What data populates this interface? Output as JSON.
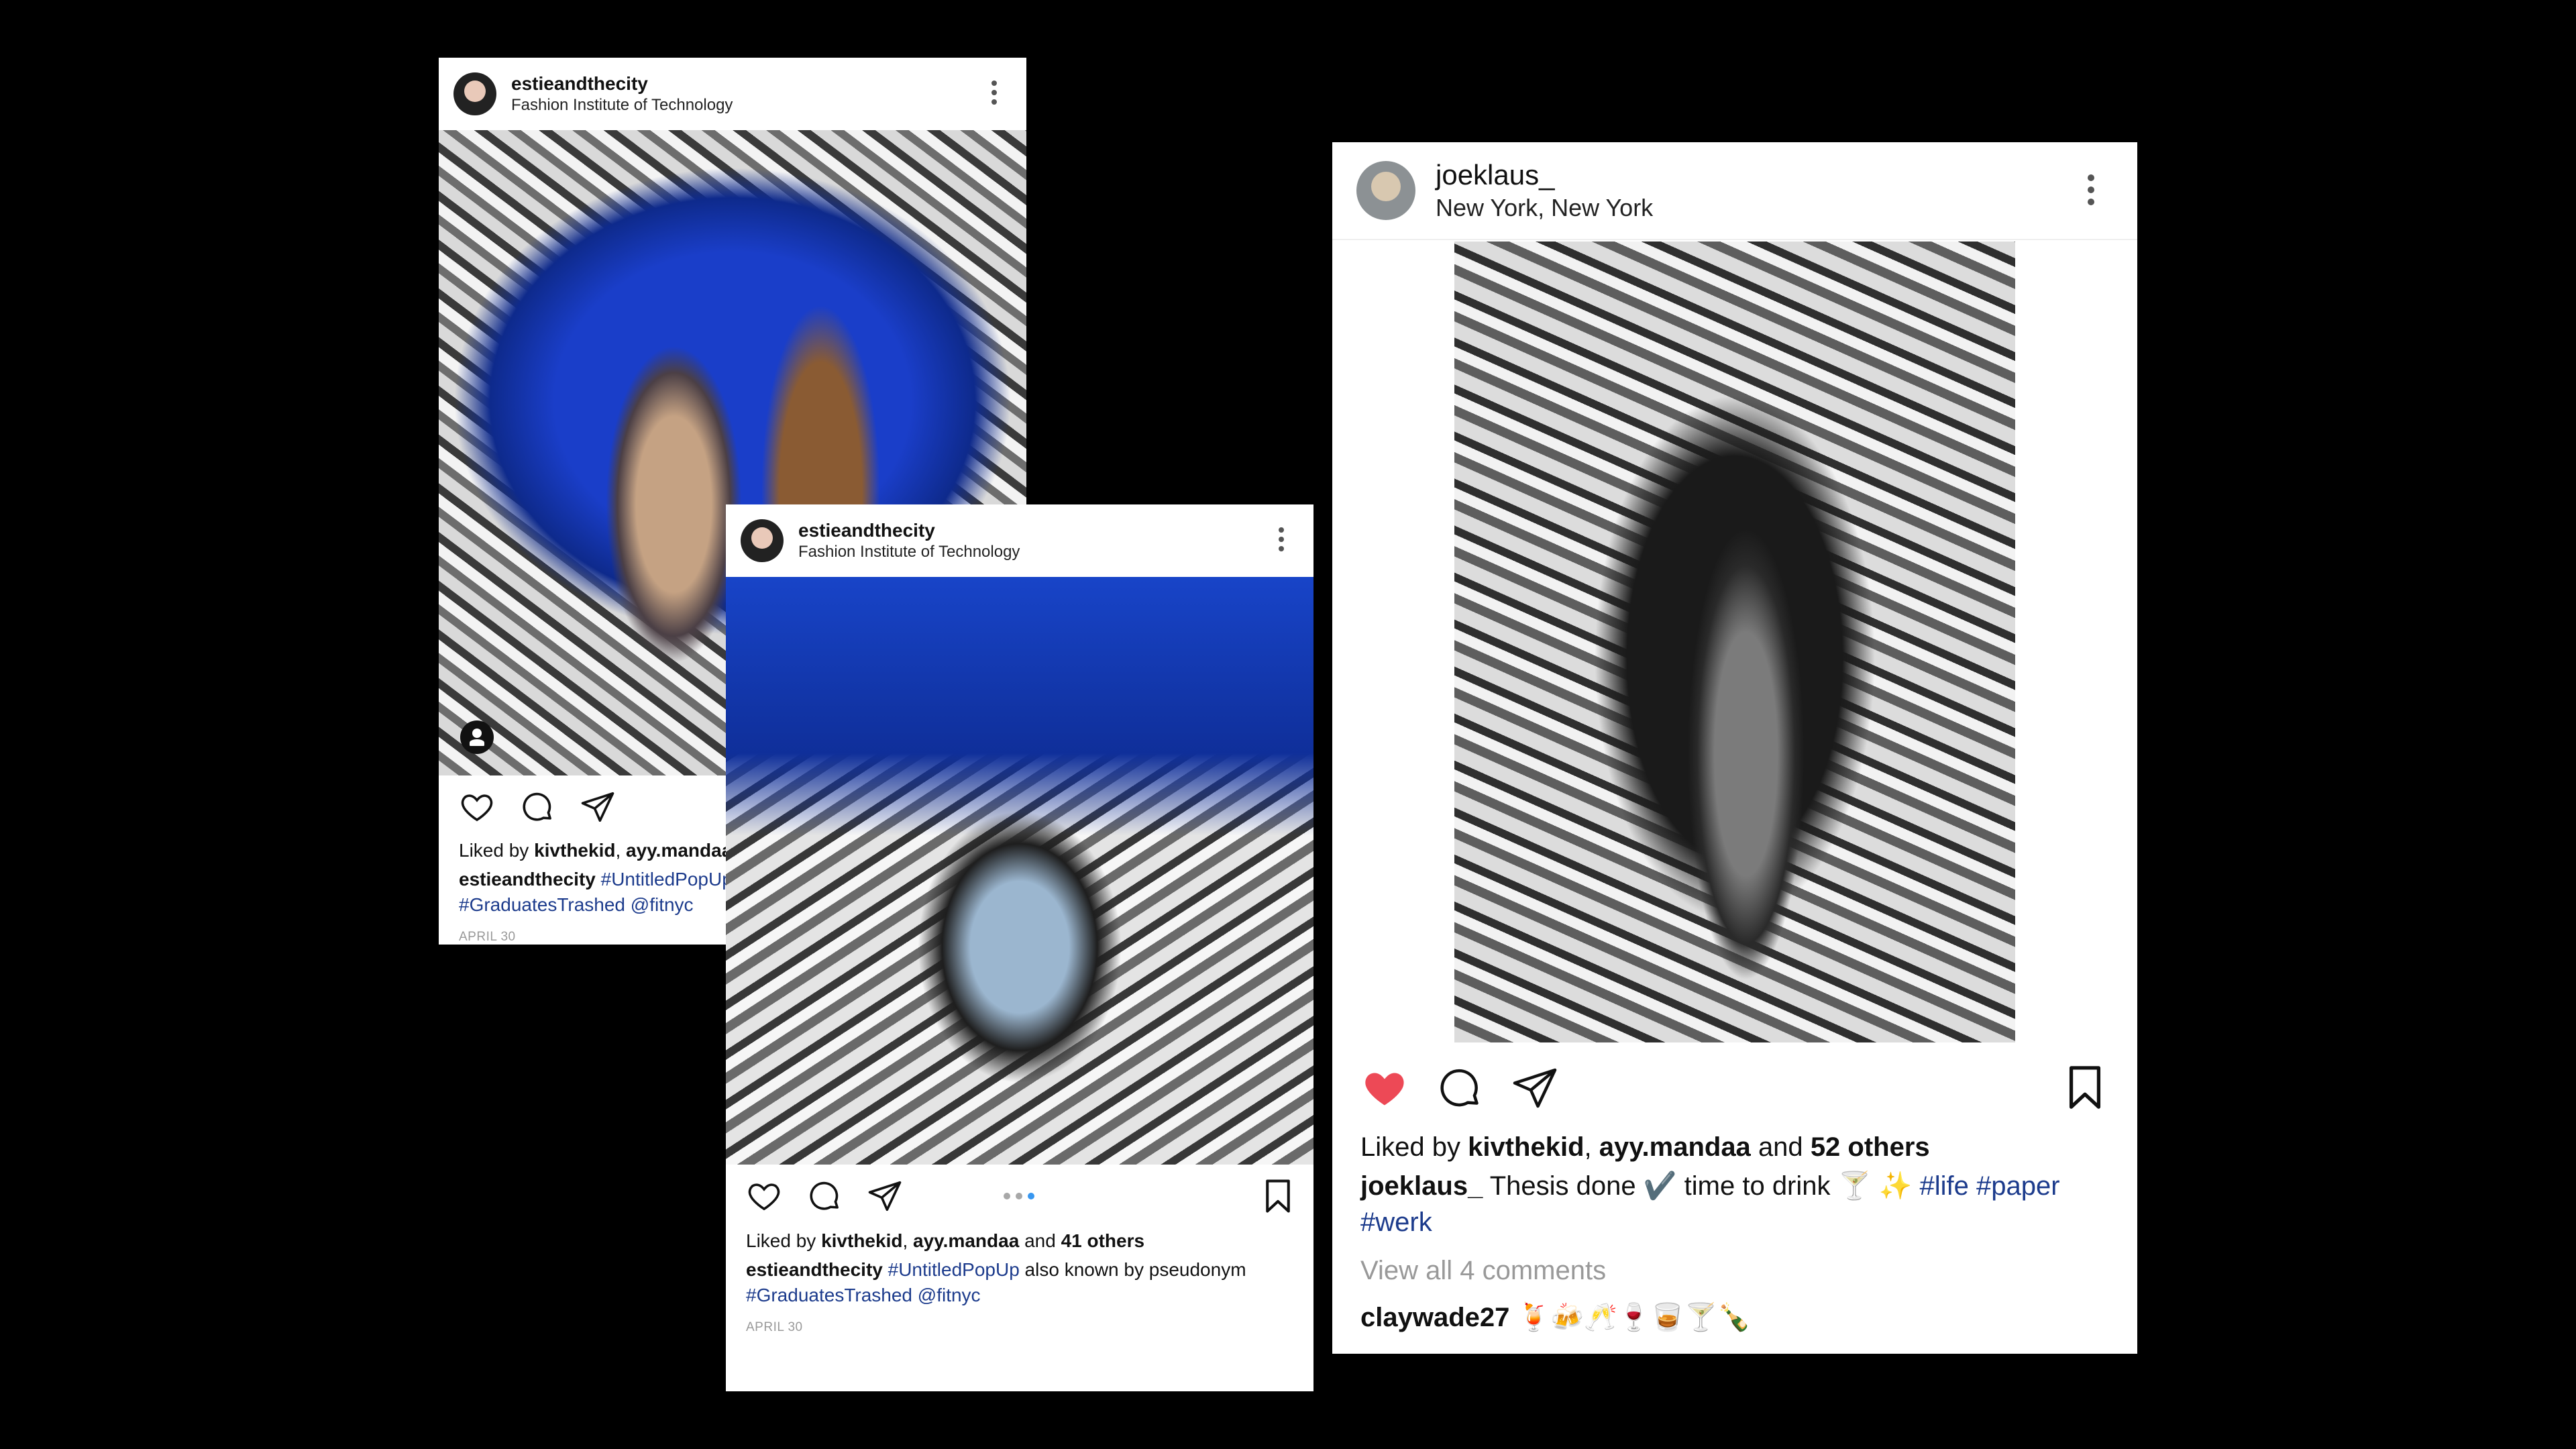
{
  "posts": [
    {
      "username": "estieandthecity",
      "location": "Fashion Institute of Technology",
      "liked_prefix": "Liked by",
      "liked_user1": "kivthekid",
      "liked_user2": "ayy.mandaa",
      "caption_user": "estieandthecity",
      "caption_tag1": "#UntitledPopUp",
      "caption_tag2": "#GraduatesTrashed",
      "caption_mention": "@fitnyc",
      "date": "APRIL 30"
    },
    {
      "username": "estieandthecity",
      "location": "Fashion Institute of Technology",
      "liked_prefix": "Liked by",
      "liked_user1": "kivthekid",
      "liked_user2": "ayy.mandaa",
      "liked_and": "and",
      "liked_others": "41 others",
      "caption_user": "estieandthecity",
      "caption_tag1": "#UntitledPopUp",
      "caption_text": "also known by pseudonym",
      "caption_tag2": "#GraduatesTrashed",
      "caption_mention": "@fitnyc",
      "date": "APRIL 30",
      "carousel_active_index": 3,
      "carousel_count": 3
    },
    {
      "username": "joeklaus_",
      "location": "New York, New York",
      "liked_prefix": "Liked by",
      "liked_user1": "kivthekid",
      "liked_user2": "ayy.mandaa",
      "liked_and": "and",
      "liked_others": "52 others",
      "caption_user": "joeklaus_",
      "caption_text": "Thesis done ✔️ time to drink 🍸 ✨",
      "caption_tag1": "#life",
      "caption_tag2": "#paper",
      "caption_tag3": "#werk",
      "view_comments": "View all 4 comments",
      "comment_user": "claywade27",
      "comment_text": "🍹🍻🥂🍷🥃🍸🍾",
      "liked": true
    }
  ],
  "colors": {
    "background": "#000000",
    "card": "#ffffff",
    "hashtag": "#1c3b8c",
    "heart_liked": "#ed4956",
    "carousel_active": "#3897f0",
    "muted": "#999999"
  },
  "icons": [
    "heart-icon",
    "comment-icon",
    "share-icon",
    "bookmark-icon",
    "more-options-icon",
    "user-tag-icon"
  ]
}
